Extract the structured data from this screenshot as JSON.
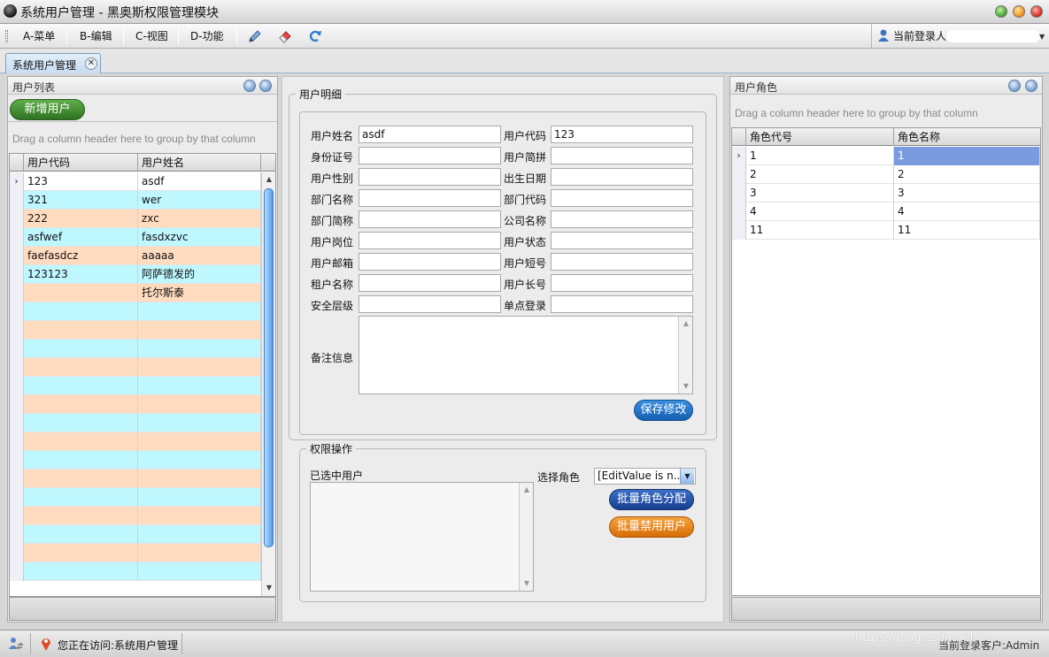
{
  "window": {
    "title": "系统用户管理 - 黑奥斯权限管理模块"
  },
  "menu": {
    "items": [
      "A-菜单",
      "B-编辑",
      "C-视图",
      "D-功能"
    ],
    "current_user_label": "当前登录人"
  },
  "toolbar_icons": [
    "pen-icon",
    "eraser-icon",
    "refresh-icon"
  ],
  "tab": {
    "label": "系统用户管理"
  },
  "user_list": {
    "title": "用户列表",
    "add_button": "新增用户",
    "group_hint": "Drag a column header here to group by that column",
    "columns": [
      "用户代码",
      "用户姓名"
    ],
    "rows": [
      [
        "123",
        "asdf"
      ],
      [
        "321",
        "wer"
      ],
      [
        "222",
        "zxc"
      ],
      [
        "asfwef",
        "fasdxzvc"
      ],
      [
        "faefasdcz",
        "aaaaa"
      ],
      [
        "123123",
        "阿萨德发的"
      ],
      [
        "",
        "托尔斯泰"
      ],
      [
        "",
        ""
      ],
      [
        "",
        ""
      ],
      [
        "",
        ""
      ],
      [
        "",
        ""
      ],
      [
        "",
        ""
      ],
      [
        "",
        ""
      ],
      [
        "",
        ""
      ],
      [
        "",
        ""
      ],
      [
        "",
        ""
      ],
      [
        "",
        ""
      ],
      [
        "",
        ""
      ],
      [
        "",
        ""
      ],
      [
        "",
        ""
      ],
      [
        "",
        ""
      ],
      [
        "",
        ""
      ]
    ]
  },
  "detail": {
    "legend": "用户明细",
    "fields_left": [
      {
        "label": "用户姓名",
        "value": "asdf"
      },
      {
        "label": "身份证号",
        "value": ""
      },
      {
        "label": "用户性别",
        "value": ""
      },
      {
        "label": "部门名称",
        "value": ""
      },
      {
        "label": "部门简称",
        "value": ""
      },
      {
        "label": "用户岗位",
        "value": ""
      },
      {
        "label": "用户邮箱",
        "value": ""
      },
      {
        "label": "租户名称",
        "value": ""
      },
      {
        "label": "安全层级",
        "value": ""
      }
    ],
    "fields_right": [
      {
        "label": "用户代码",
        "value": "123"
      },
      {
        "label": "用户简拼",
        "value": ""
      },
      {
        "label": "出生日期",
        "value": ""
      },
      {
        "label": "部门代码",
        "value": ""
      },
      {
        "label": "公司名称",
        "value": ""
      },
      {
        "label": "用户状态",
        "value": ""
      },
      {
        "label": "用户短号",
        "value": ""
      },
      {
        "label": "用户长号",
        "value": ""
      },
      {
        "label": "单点登录",
        "value": ""
      }
    ],
    "remarks_label": "备注信息",
    "save_button": "保存修改"
  },
  "permission": {
    "legend": "权限操作",
    "selected_users_label": "已选中用户",
    "select_role_label": "选择角色",
    "role_select_value": "[EditValue is n...",
    "assign_button": "批量角色分配",
    "disable_button": "批量禁用用户"
  },
  "user_roles": {
    "title": "用户角色",
    "group_hint": "Drag a column header here to group by that column",
    "columns": [
      "角色代号",
      "角色名称"
    ],
    "rows": [
      [
        "1",
        "1"
      ],
      [
        "2",
        "2"
      ],
      [
        "3",
        "3"
      ],
      [
        "4",
        "4"
      ],
      [
        "11",
        "11"
      ]
    ]
  },
  "status": {
    "location_text": "您正在访问:系统用户管理",
    "watermark": "https://blog.csdn.net/",
    "right_text": "当前登录客户:Admin"
  },
  "colors": {
    "row_even": "#ffdcc0",
    "row_odd": "#bff7ff",
    "selected_cell": "#7b9be0",
    "save": "#1f72c9",
    "assign": "#1f56a8",
    "disable": "#e07a10",
    "add": "#3b7f2c"
  }
}
